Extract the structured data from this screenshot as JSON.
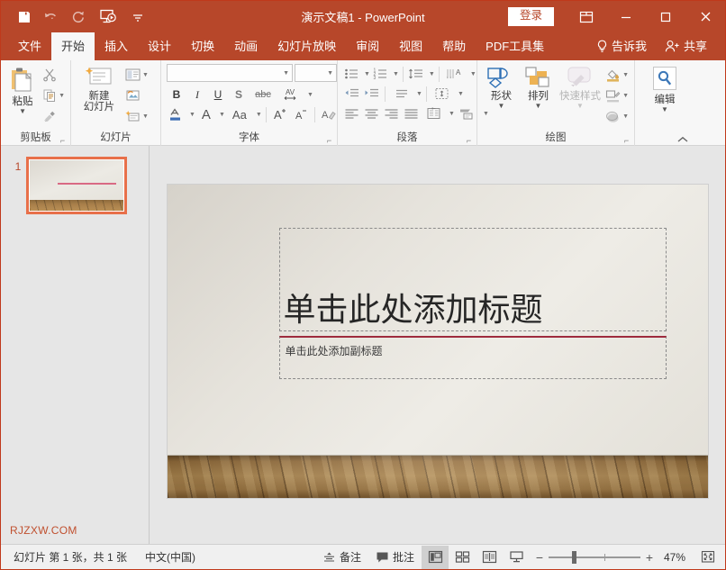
{
  "titlebar": {
    "document_title": "演示文稿1",
    "separator": "-",
    "app_name": "PowerPoint",
    "signin_label": "登录",
    "quick_access": [
      {
        "name": "save-icon",
        "label": "保存"
      },
      {
        "name": "undo-icon",
        "label": "撤消"
      },
      {
        "name": "redo-icon",
        "label": "恢复"
      },
      {
        "name": "start-slideshow-icon",
        "label": "从头开始"
      },
      {
        "name": "customize-qat-icon",
        "label": "自定义快速访问工具栏"
      }
    ],
    "window_controls": [
      {
        "name": "ribbon-display-options-icon",
        "label": "功能区显示选项"
      },
      {
        "name": "minimize-icon",
        "label": "最小化"
      },
      {
        "name": "maximize-icon",
        "label": "最大化"
      },
      {
        "name": "close-icon",
        "label": "关闭"
      }
    ],
    "accent_color": "#b7472a"
  },
  "tabs": {
    "items": [
      {
        "label": "文件",
        "active": false
      },
      {
        "label": "开始",
        "active": true
      },
      {
        "label": "插入",
        "active": false
      },
      {
        "label": "设计",
        "active": false
      },
      {
        "label": "切换",
        "active": false
      },
      {
        "label": "动画",
        "active": false
      },
      {
        "label": "幻灯片放映",
        "active": false
      },
      {
        "label": "审阅",
        "active": false
      },
      {
        "label": "视图",
        "active": false
      },
      {
        "label": "帮助",
        "active": false
      },
      {
        "label": "PDF工具集",
        "active": false
      }
    ],
    "tell_me": "告诉我",
    "share": "共享"
  },
  "ribbon": {
    "groups": [
      {
        "name": "clipboard",
        "label": "剪贴板",
        "paste_label": "粘贴",
        "small_buttons": [
          {
            "label": "剪切",
            "icon": "scissors-icon"
          },
          {
            "label": "复制",
            "icon": "copy-icon"
          },
          {
            "label": "格式刷",
            "icon": "format-painter-icon"
          }
        ]
      },
      {
        "name": "slides",
        "label": "幻灯片",
        "new_slide_label_line1": "新建",
        "new_slide_label_line2": "幻灯片",
        "small_buttons": [
          {
            "label": "版式",
            "icon": "layout-icon"
          },
          {
            "label": "重置",
            "icon": "reset-icon"
          },
          {
            "label": "节",
            "icon": "section-icon"
          }
        ]
      },
      {
        "name": "font",
        "label": "字体",
        "font_name_value": "",
        "font_name_placeholder": "",
        "font_size_value": "",
        "font_size_placeholder": "",
        "buttons": [
          {
            "label": "B",
            "name": "bold-button"
          },
          {
            "label": "I",
            "name": "italic-button"
          },
          {
            "label": "U",
            "name": "underline-button"
          },
          {
            "label": "S",
            "name": "shadow-button"
          },
          {
            "label": "abc",
            "name": "strikethrough-button"
          },
          {
            "label": "AV",
            "name": "character-spacing-button"
          }
        ],
        "row2": [
          {
            "name": "font-color-button",
            "label": "字体颜色"
          },
          {
            "name": "clear-formatting-a-button",
            "label": "A"
          },
          {
            "name": "change-case-button",
            "label": "Aa"
          },
          {
            "name": "increase-font-size-button",
            "label": "A"
          },
          {
            "name": "decrease-font-size-button",
            "label": "A"
          },
          {
            "name": "clear-all-formatting-button",
            "label": "清除所有格式"
          }
        ]
      },
      {
        "name": "paragraph",
        "label": "段落",
        "buttons": [
          {
            "name": "bullets-button",
            "label": "项目符号"
          },
          {
            "name": "numbering-button",
            "label": "编号"
          },
          {
            "name": "line-spacing-button",
            "label": "行距"
          },
          {
            "name": "text-direction-button",
            "label": "文字方向"
          },
          {
            "name": "decrease-indent-button",
            "label": "减少缩进量"
          },
          {
            "name": "increase-indent-button",
            "label": "增加缩进量"
          },
          {
            "name": "paragraph-spacing-button",
            "label": "段落间距"
          },
          {
            "name": "align-text-button",
            "label": "对齐文本"
          },
          {
            "name": "align-left-button",
            "label": "左对齐"
          },
          {
            "name": "align-center-button",
            "label": "居中"
          },
          {
            "name": "align-right-button",
            "label": "右对齐"
          },
          {
            "name": "justify-button",
            "label": "两端对齐"
          },
          {
            "name": "columns-button",
            "label": "分栏"
          },
          {
            "name": "convert-to-smartart-button",
            "label": "转换为SmartArt"
          }
        ]
      },
      {
        "name": "drawing",
        "label": "绘图",
        "shapes_label": "形状",
        "arrange_label": "排列",
        "quick_styles_label": "快速样式",
        "quick_styles_disabled": true,
        "small_buttons": [
          {
            "label": "形状填充",
            "icon": "shape-fill-icon"
          },
          {
            "label": "形状轮廓",
            "icon": "shape-outline-icon"
          },
          {
            "label": "形状效果",
            "icon": "shape-effects-icon"
          }
        ]
      },
      {
        "name": "editing",
        "label": "编辑",
        "edit_label": "编辑"
      }
    ],
    "collapse_label": "折叠功能区"
  },
  "thumbnail_pane": {
    "slides": [
      {
        "number": "1",
        "selected": true
      }
    ],
    "watermark": "RJZXW.COM"
  },
  "slide": {
    "title_placeholder": "单击此处添加标题",
    "subtitle_placeholder": "单击此处添加副标题",
    "accent_line_color": "#9e2b3d"
  },
  "statusbar": {
    "slide_count_text": "幻灯片 第 1 张，共 1 张",
    "language": "中文(中国)",
    "notes_label": "备注",
    "comments_label": "批注",
    "views": [
      {
        "name": "normal-view-button",
        "label": "普通视图",
        "active": true
      },
      {
        "name": "slide-sorter-view-button",
        "label": "幻灯片浏览",
        "active": false
      },
      {
        "name": "reading-view-button",
        "label": "阅读视图",
        "active": false
      },
      {
        "name": "slideshow-view-button",
        "label": "幻灯片放映",
        "active": false
      }
    ],
    "zoom_out": "−",
    "zoom_in": "+",
    "zoom_level": "47%",
    "fit_label": "使幻灯片适应当前窗口"
  }
}
